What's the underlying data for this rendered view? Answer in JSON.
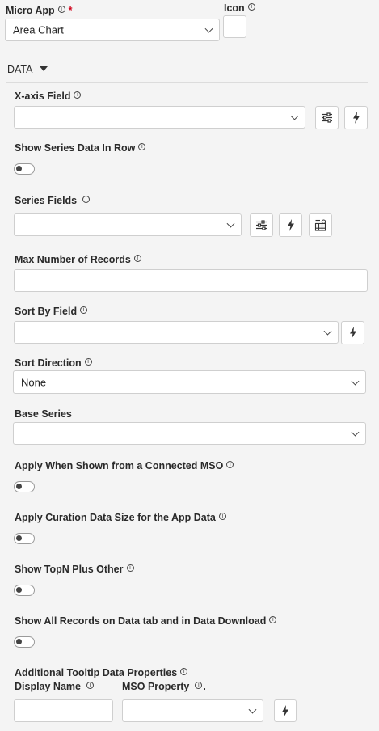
{
  "micro_app": {
    "label": "Micro App",
    "required_mark": "*",
    "value": "Area Chart"
  },
  "icon_field": {
    "label": "Icon"
  },
  "section": {
    "label": "DATA"
  },
  "x_axis": {
    "label": "X-axis Field",
    "value": ""
  },
  "show_series_row": {
    "label": "Show Series Data In Row",
    "on": false
  },
  "series_fields": {
    "label": "Series Fields",
    "value": ""
  },
  "max_records": {
    "label": "Max Number of Records",
    "value": ""
  },
  "sort_by": {
    "label": "Sort By Field",
    "value": ""
  },
  "sort_direction": {
    "label": "Sort Direction",
    "value": "None"
  },
  "base_series": {
    "label": "Base Series",
    "value": ""
  },
  "apply_connected": {
    "label": "Apply When Shown from a Connected MSO",
    "on": false
  },
  "apply_curation": {
    "label": "Apply Curation Data Size for the App Data",
    "on": false
  },
  "topn": {
    "label": "Show TopN Plus Other",
    "on": false
  },
  "all_records": {
    "label": "Show All Records on Data tab and in Data Download",
    "on": false
  },
  "tooltip_props": {
    "label": "Additional Tooltip Data Properties",
    "display_name_label": "Display Name",
    "mso_property_label": "MSO Property",
    "mso_suffix": ".",
    "display_name_value": "",
    "mso_property_value": ""
  },
  "info_glyph": "i",
  "icons": [
    "info-icon",
    "chevron-down-icon",
    "sliders-icon",
    "lightning-icon",
    "table-settings-icon",
    "caret-down-icon"
  ]
}
